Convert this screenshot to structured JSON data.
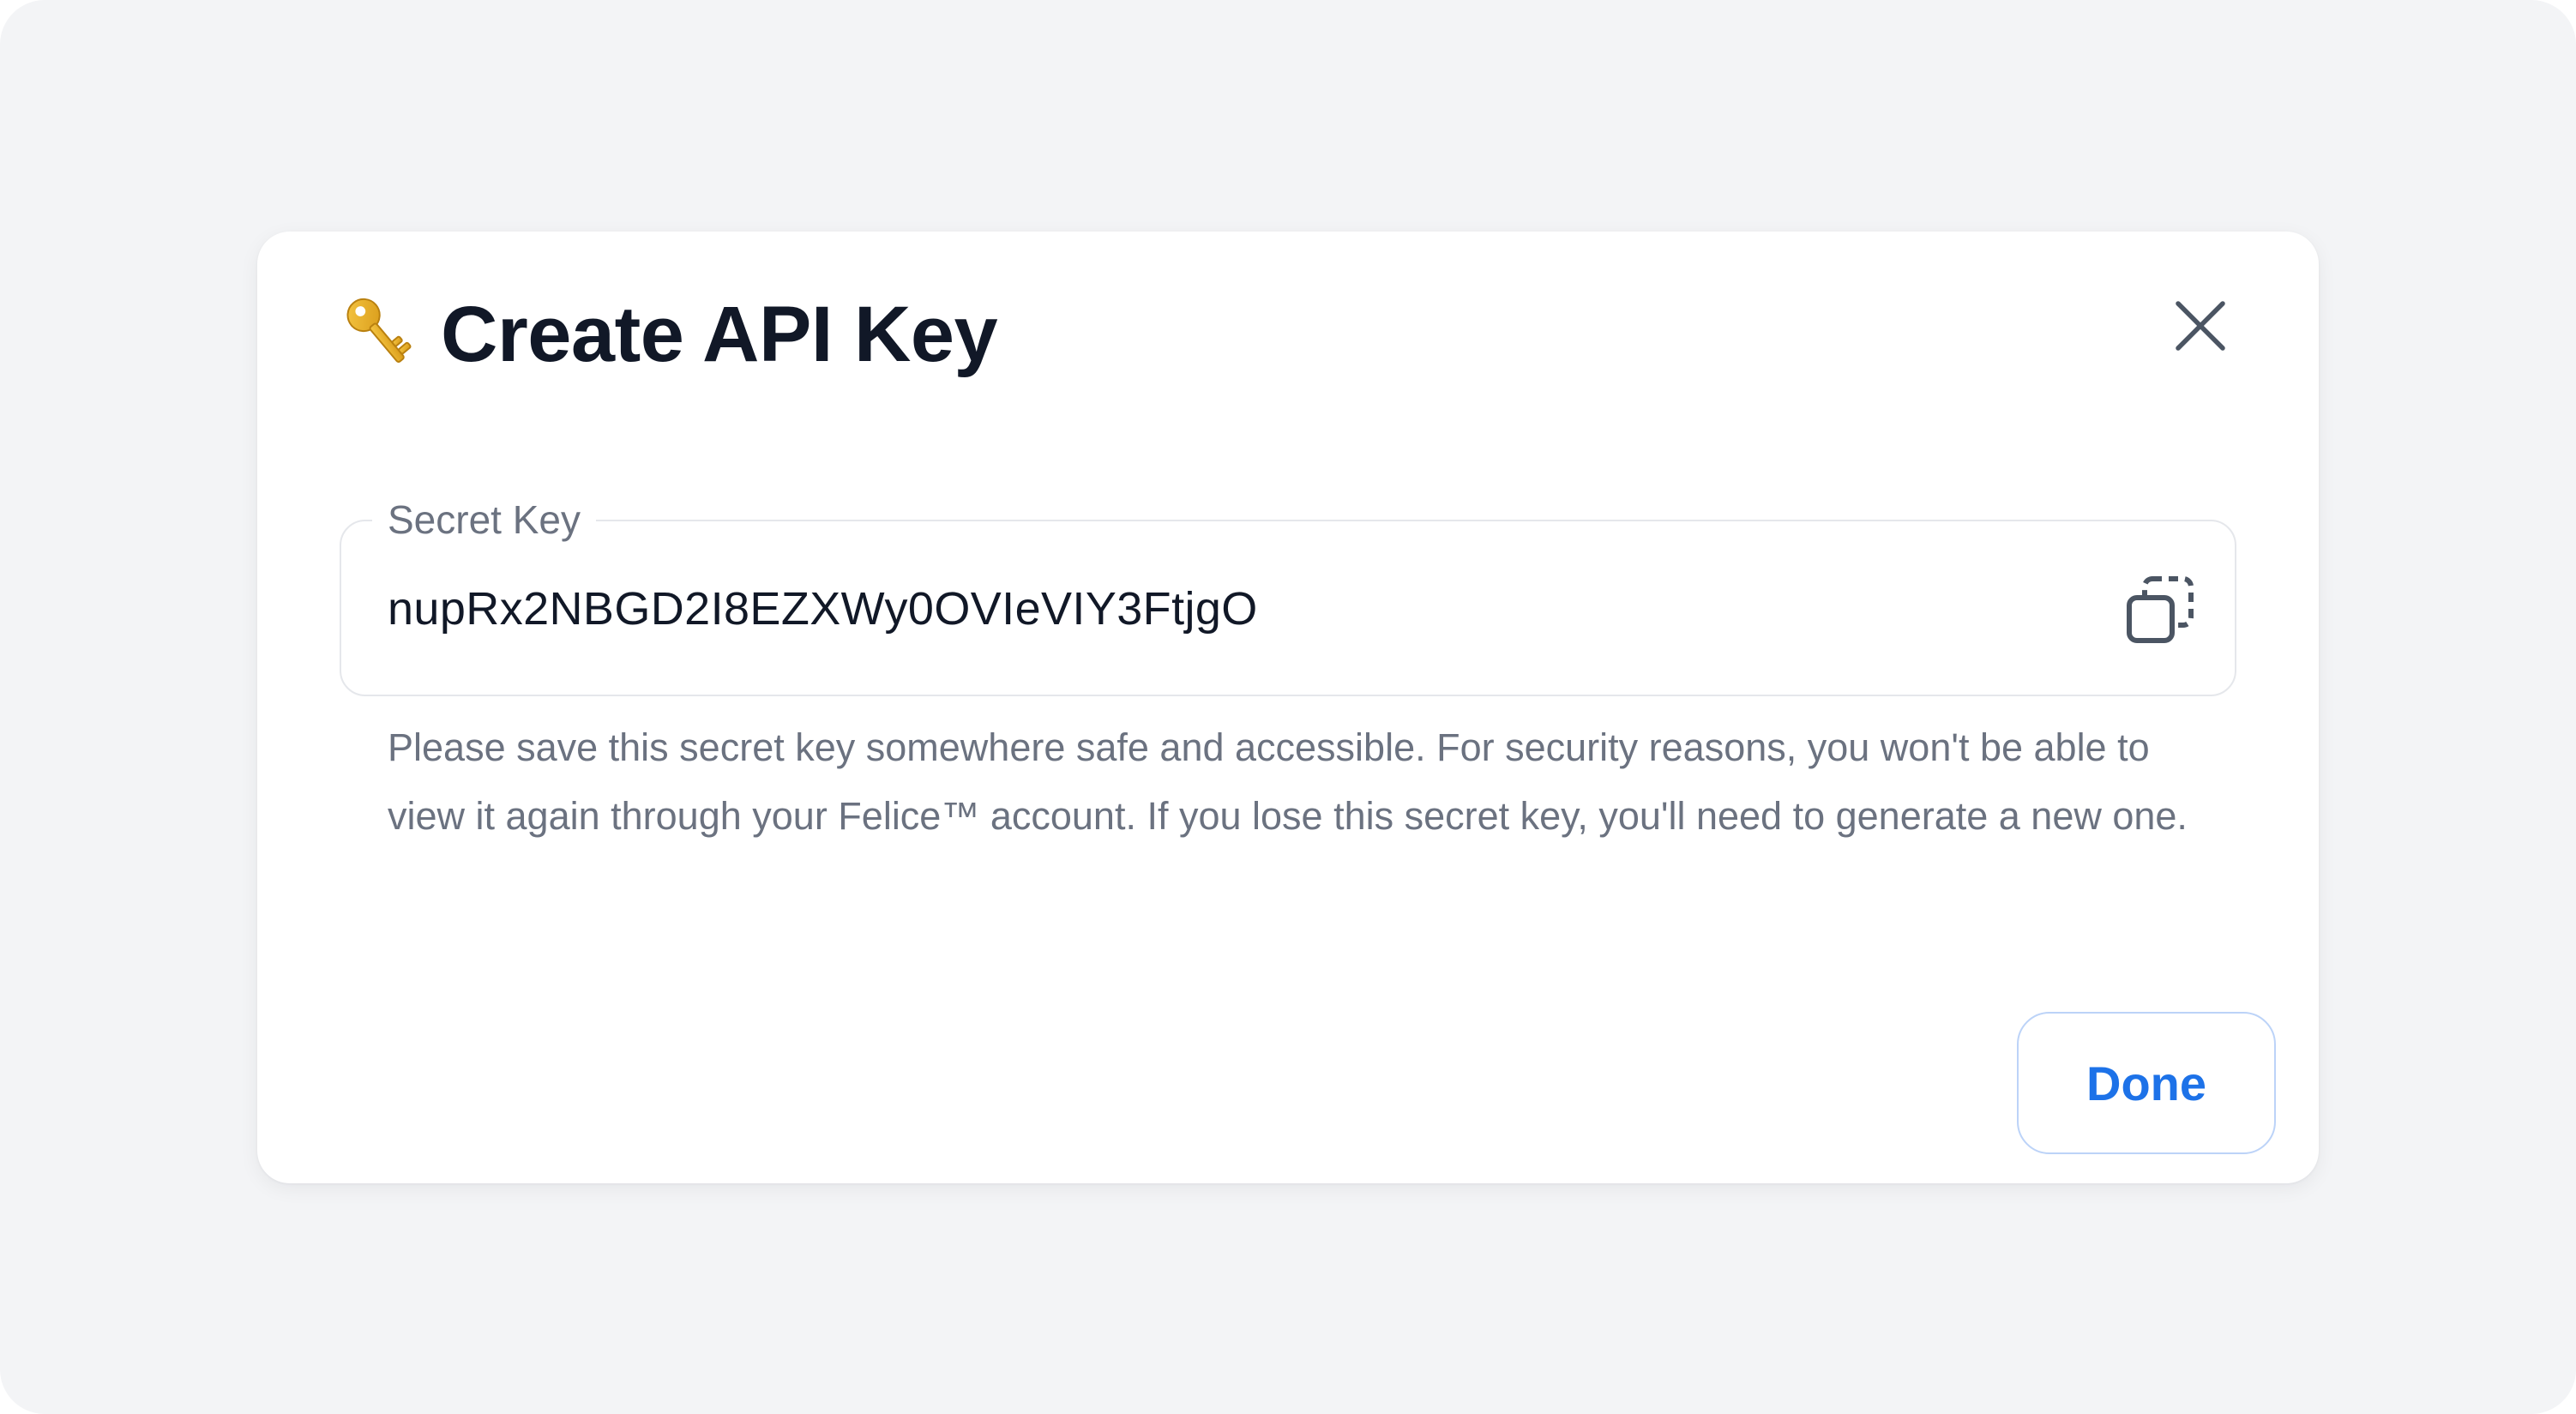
{
  "modal": {
    "title": "Create API Key",
    "title_icon": "key-icon",
    "close_icon": "close-icon"
  },
  "secret_key": {
    "label": "Secret Key",
    "value": "nupRx2NBGD2I8EZXWy0OVIeVIY3FtjgO",
    "copy_icon": "copy-icon"
  },
  "helper_text": "Please save this secret key somewhere safe and accessible. For security reasons, you won't be able to view it again through your Felice™ account. If you lose this secret key, you'll need to generate a new one.",
  "actions": {
    "done_label": "Done"
  },
  "colors": {
    "page_background": "#f3f4f6",
    "modal_background": "#ffffff",
    "title_text": "#111827",
    "muted_text": "#6b7280",
    "accent": "#1d72e8",
    "border": "#e5e7eb"
  }
}
